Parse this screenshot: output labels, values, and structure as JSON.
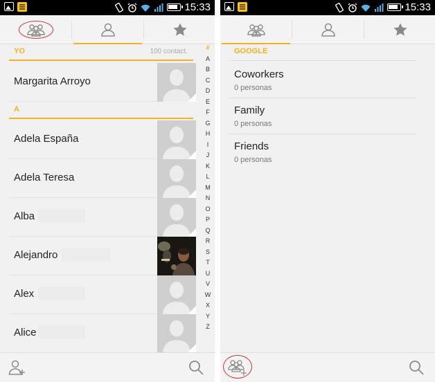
{
  "status_bar": {
    "time": "15:33"
  },
  "left": {
    "section_yo": {
      "label": "YO",
      "count": "100 contact."
    },
    "section_a": {
      "label": "A"
    },
    "contacts": [
      {
        "name": "Margarita Arroyo",
        "avatar": "placeholder"
      },
      {
        "name": "Adela España",
        "avatar": "placeholder"
      },
      {
        "name": "Adela Teresa",
        "avatar": "placeholder"
      },
      {
        "name": "Alba",
        "avatar": "placeholder"
      },
      {
        "name": "Alejandro",
        "avatar": "photo"
      },
      {
        "name": "Alex",
        "avatar": "placeholder"
      },
      {
        "name": "Alice",
        "avatar": "placeholder"
      }
    ],
    "index_letters": [
      "#",
      "A",
      "B",
      "C",
      "D",
      "E",
      "F",
      "G",
      "H",
      "I",
      "J",
      "K",
      "L",
      "M",
      "N",
      "O",
      "P",
      "Q",
      "R",
      "S",
      "T",
      "U",
      "V",
      "W",
      "X",
      "Y",
      "Z"
    ]
  },
  "right": {
    "section_google": {
      "label": "GOOGLE"
    },
    "groups": [
      {
        "name": "Coworkers",
        "count": "0 personas"
      },
      {
        "name": "Family",
        "count": "0 personas"
      },
      {
        "name": "Friends",
        "count": "0 personas"
      }
    ]
  },
  "icons": {
    "tab_groups": "group-icon",
    "tab_contacts": "person-icon",
    "tab_favorites": "star-icon",
    "add_contact": "add-person-icon",
    "add_group": "add-group-icon",
    "search": "search-icon"
  },
  "colors": {
    "accent": "#f0b321",
    "annotation": "#cc3333"
  }
}
